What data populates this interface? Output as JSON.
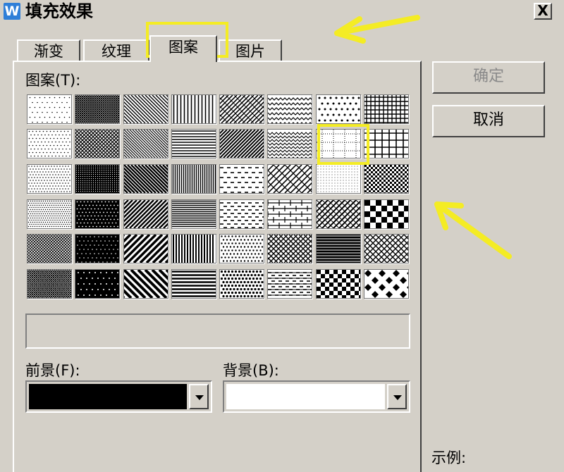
{
  "window": {
    "title": "填充效果",
    "app_icon_label": "W",
    "close_label": "X"
  },
  "tabs": [
    {
      "label": "渐变",
      "active": false
    },
    {
      "label": "纹理",
      "active": false
    },
    {
      "label": "图案",
      "active": true
    },
    {
      "label": "图片",
      "active": false
    }
  ],
  "pattern_section": {
    "label": "图案(T):",
    "selected_row": 2,
    "selected_col": 7
  },
  "foreground": {
    "label": "前景(F):",
    "value_color": "#000000"
  },
  "background": {
    "label": "背景(B):",
    "value_color": "#ffffff"
  },
  "buttons": {
    "ok": "确定",
    "cancel": "取消"
  },
  "sample_label": "示例:",
  "highlight_color": "#f4ec24"
}
